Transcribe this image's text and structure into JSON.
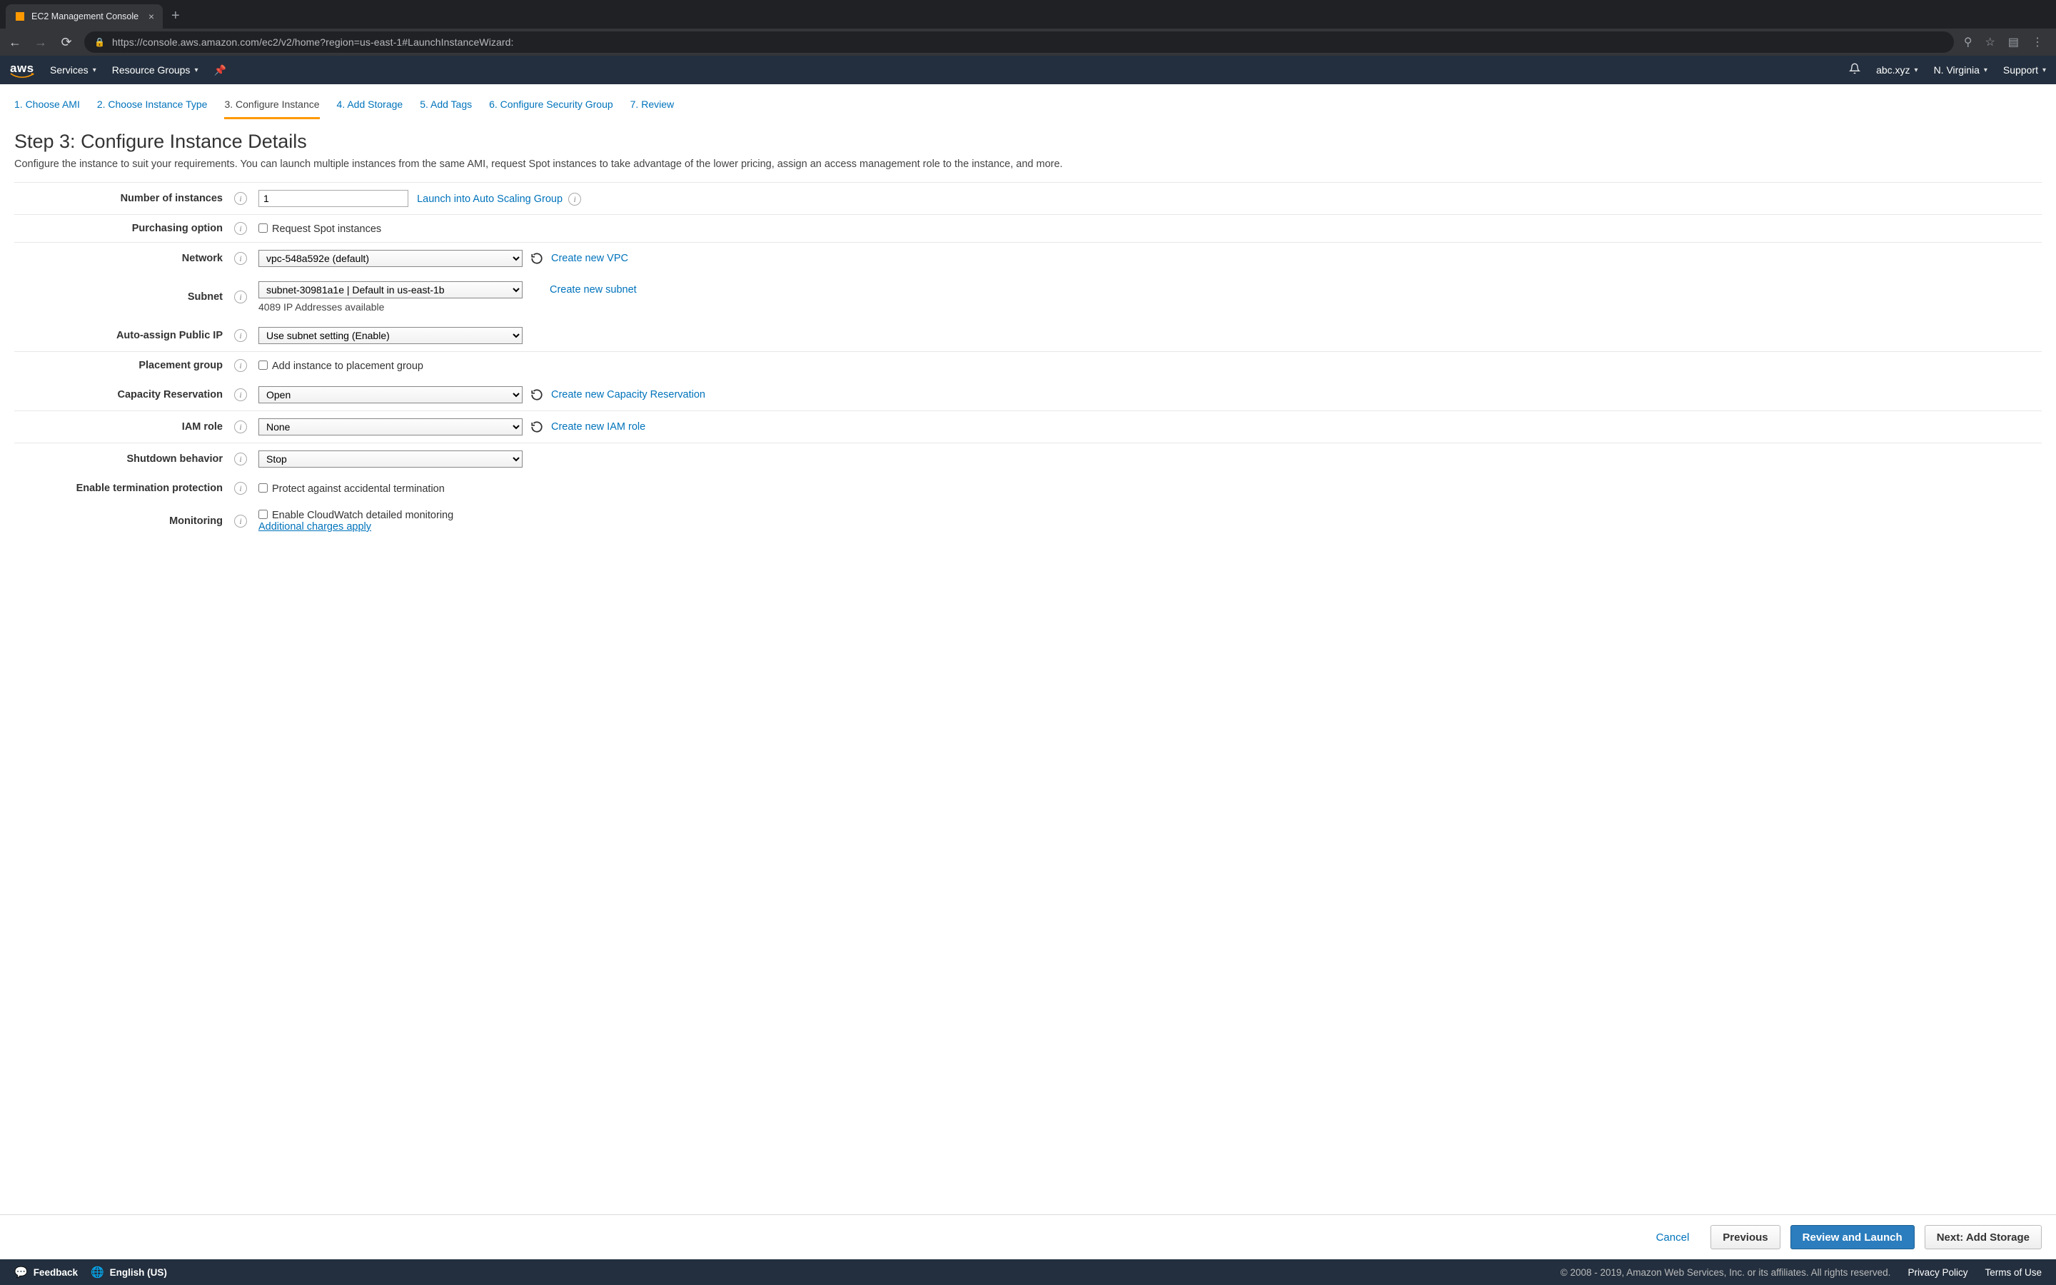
{
  "browser": {
    "tab_title": "EC2 Management Console",
    "url": "https://console.aws.amazon.com/ec2/v2/home?region=us-east-1#LaunchInstanceWizard:"
  },
  "aws_nav": {
    "services": "Services",
    "resource_groups": "Resource Groups",
    "account": "abc.xyz",
    "region": "N. Virginia",
    "support": "Support"
  },
  "wizard": {
    "steps": [
      "1. Choose AMI",
      "2. Choose Instance Type",
      "3. Configure Instance",
      "4. Add Storage",
      "5. Add Tags",
      "6. Configure Security Group",
      "7. Review"
    ],
    "active_index": 2
  },
  "page": {
    "title": "Step 3: Configure Instance Details",
    "description": "Configure the instance to suit your requirements. You can launch multiple instances from the same AMI, request Spot instances to take advantage of the lower pricing, assign an access management role to the instance, and more."
  },
  "form": {
    "num_instances_label": "Number of instances",
    "num_instances_value": "1",
    "launch_asg_link": "Launch into Auto Scaling Group",
    "purchasing_label": "Purchasing option",
    "purchasing_checkbox": "Request Spot instances",
    "network_label": "Network",
    "network_select": "vpc-548a592e (default)",
    "network_link": "Create new VPC",
    "subnet_label": "Subnet",
    "subnet_select": "subnet-30981a1e | Default in us-east-1b",
    "subnet_sub": "4089 IP Addresses available",
    "subnet_link": "Create new subnet",
    "autoip_label": "Auto-assign Public IP",
    "autoip_select": "Use subnet setting (Enable)",
    "placement_label": "Placement group",
    "placement_checkbox": "Add instance to placement group",
    "capres_label": "Capacity Reservation",
    "capres_select": "Open",
    "capres_link": "Create new Capacity Reservation",
    "iam_label": "IAM role",
    "iam_select": "None",
    "iam_link": "Create new IAM role",
    "shutdown_label": "Shutdown behavior",
    "shutdown_select": "Stop",
    "termprot_label": "Enable termination protection",
    "termprot_checkbox": "Protect against accidental termination",
    "monitoring_label": "Monitoring",
    "monitoring_checkbox": "Enable CloudWatch detailed monitoring",
    "monitoring_sub": "Additional charges apply"
  },
  "actions": {
    "cancel": "Cancel",
    "previous": "Previous",
    "review": "Review and Launch",
    "next": "Next: Add Storage"
  },
  "footer": {
    "feedback": "Feedback",
    "language": "English (US)",
    "copyright": "© 2008 - 2019, Amazon Web Services, Inc. or its affiliates. All rights reserved.",
    "privacy": "Privacy Policy",
    "terms": "Terms of Use"
  }
}
